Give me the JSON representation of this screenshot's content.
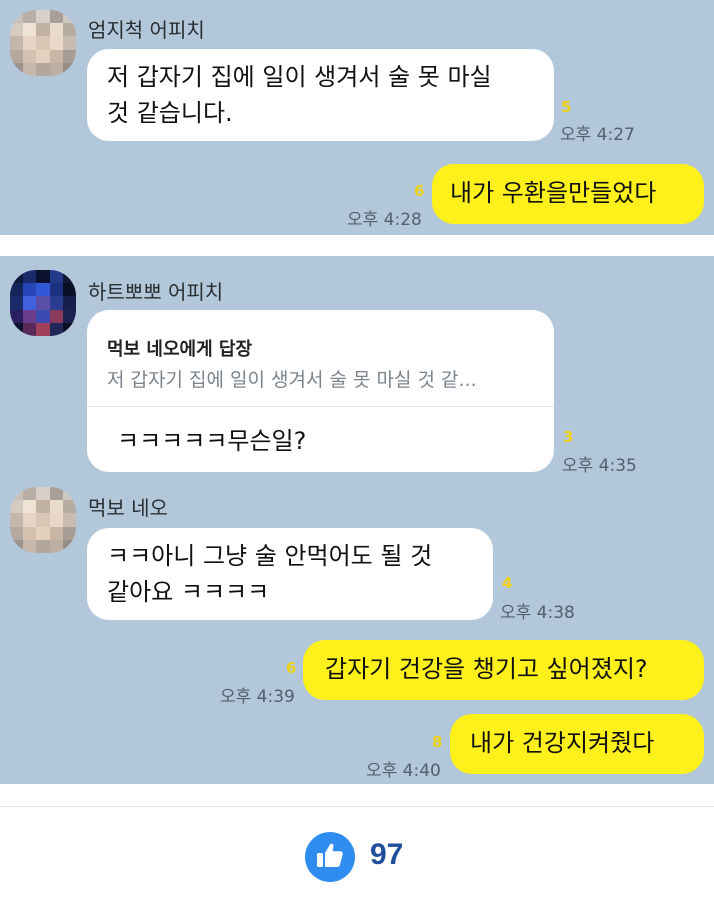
{
  "panel1": {
    "sender": "엄지척 어피치",
    "msg1": {
      "line1": "저 갑자기 집에 일이 생겨서 술 못 마실",
      "line2": "것 같습니다.",
      "unread": "5",
      "time": "오후 4:27"
    },
    "msg2": {
      "text": "내가 우환을만들었다",
      "unread": "6",
      "time": "오후 4:28"
    }
  },
  "panel2": {
    "sender1": "하트뽀뽀 어피치",
    "reply_msg": {
      "reply_to": "먹보 네오에게 답장",
      "quote": "저 갑자기 집에 일이 생겨서 술 못 마실 것 같...",
      "text": "ㅋㅋㅋㅋㅋ무슨일?",
      "unread": "3",
      "time": "오후 4:35"
    },
    "sender2": "먹보 네오",
    "msg3": {
      "line1": "ㅋㅋ아니 그냥 술 안먹어도 될 것",
      "line2": "같아요 ㅋㅋㅋㅋ",
      "unread": "4",
      "time": "오후 4:38"
    },
    "msg4": {
      "text": "갑자기 건강을 챙기고 싶어졌지?",
      "unread": "6",
      "time": "오후 4:39"
    },
    "msg5": {
      "text": "내가 건강지켜줬다",
      "unread": "8",
      "time": "오후 4:40"
    }
  },
  "footer": {
    "like_count": "97",
    "like_icon": "thumbs-up-icon"
  },
  "colors": {
    "chat_bg": "#b2c7d9",
    "my_bubble": "#fef01b",
    "other_bubble": "#ffffff",
    "unread": "#f1d21a",
    "like": "#2f8df0"
  }
}
